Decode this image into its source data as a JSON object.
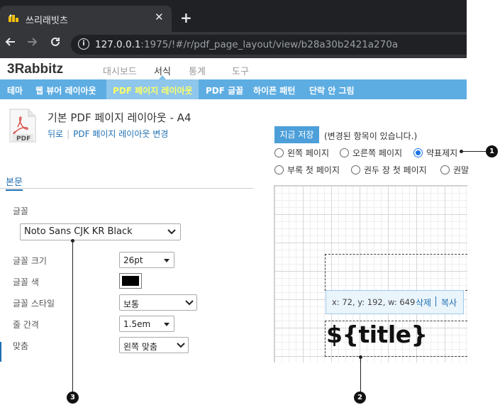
{
  "browser": {
    "tab_title": "쓰리래빗츠",
    "new_tab": "+",
    "tab_close": "✕",
    "url_host": "127.0.0.1",
    "url_rest": ":1975/!#/r/pdf_page_layout/view/b28a30b2421a270a"
  },
  "app": {
    "logo": "3Rabbitz",
    "topnav": [
      "대시보드",
      "서식",
      "통계",
      "도구"
    ],
    "menu": [
      "테마",
      "웹 뷰어 레이아웃",
      "PDF 페이지 레이아웃",
      "PDF 글꼴",
      "하이픈 패턴",
      "단락 안 그림"
    ]
  },
  "page": {
    "icon_label": "PDF",
    "title": "기본 PDF 페이지 레이아웃 - A4",
    "back_link": "뒤로",
    "change_link": "PDF 페이지 레이아웃 변경"
  },
  "form": {
    "section_tab": "본문",
    "font_label": "글꼴",
    "font_value": "Noto Sans CJK KR Black",
    "size_label": "글꼴 크기",
    "size_value": "26pt",
    "color_label": "글꼴 색",
    "color_value": "#000000",
    "style_label": "글꼴 스타일",
    "style_value": "보통",
    "spacing_label": "줄 간격",
    "spacing_value": "1.5em",
    "align_label": "맞춤",
    "align_value": "왼쪽 맞춤"
  },
  "editor": {
    "save_button": "지금 저장",
    "changed_notice": "(변경된 항목이 있습니다.)",
    "page_radios_row1": [
      "왼쪽 페이지",
      "오른쪽 페이지",
      "약표제지"
    ],
    "page_radios_row2": [
      "부록 첫 페이지",
      "권두 장 첫 페이지",
      "권말"
    ],
    "selected_radio": "약표제지",
    "coord_info": "x: 72, y: 192, w: 649",
    "delete_link": "삭제",
    "copy_link": "복사",
    "title_variable": "${title}"
  },
  "callouts": [
    "1",
    "2",
    "3"
  ]
}
